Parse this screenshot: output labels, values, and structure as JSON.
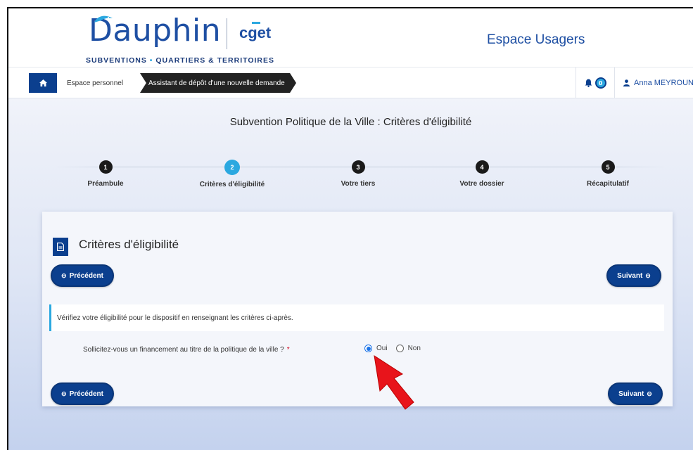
{
  "header": {
    "logo_text": "Dauphin",
    "partner_logo": "cget",
    "tagline_left": "SUBVENTIONS",
    "tagline_right": "QUARTIERS & TERRITOIRES",
    "space_title": "Espace Usagers"
  },
  "breadcrumb": {
    "home_icon": "home-icon",
    "items": [
      "Espace personnel",
      "Assistant de dépôt d'une nouvelle demande"
    ]
  },
  "user": {
    "notification_count": "0",
    "name": "Anna MEYROUN"
  },
  "page": {
    "title": "Subvention Politique de la Ville : Critères d'éligibilité"
  },
  "steps": [
    {
      "number": "1",
      "label": "Préambule",
      "active": false
    },
    {
      "number": "2",
      "label": "Critères d'éligibilité",
      "active": true
    },
    {
      "number": "3",
      "label": "Votre tiers",
      "active": false
    },
    {
      "number": "4",
      "label": "Votre dossier",
      "active": false
    },
    {
      "number": "5",
      "label": "Récapitulatif",
      "active": false
    }
  ],
  "card": {
    "title": "Critères d'éligibilité",
    "prev_label": "Précédent",
    "next_label": "Suivant",
    "info_text": "Vérifiez votre éligibilité pour le dispositif en renseignant les critères ci-après.",
    "question": "Sollicitez-vous un financement au titre de la politique de la ville ?",
    "required_mark": "*",
    "options": [
      "Oui",
      "Non"
    ],
    "selected_option": "Oui"
  },
  "colors": {
    "primary": "#0b3f8e",
    "accent": "#2ba8e0",
    "arrow": "#e8141b"
  }
}
